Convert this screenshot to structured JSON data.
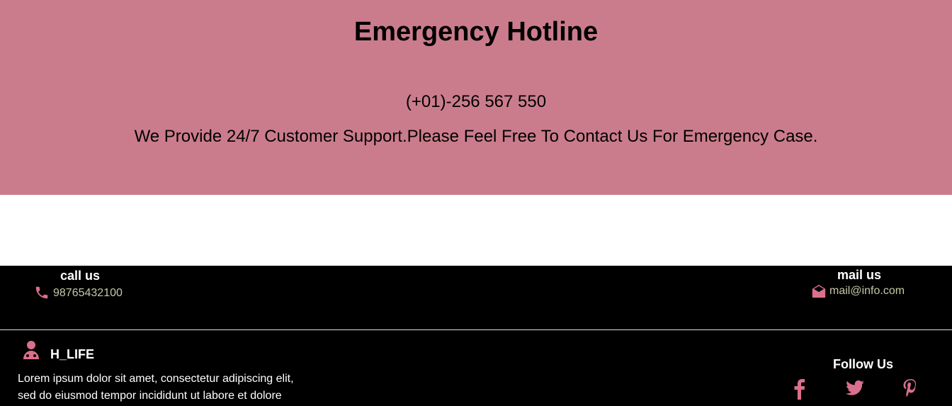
{
  "hotline": {
    "title": "Emergency Hotline",
    "phone": "(+01)-256 567 550",
    "description": "We Provide 24/7 Customer Support.Please Feel Free To Contact Us For Emergency Case."
  },
  "contact": {
    "call_heading": "call us",
    "call_number": "98765432100",
    "mail_heading": "mail us",
    "mail_address": "mail@info.com"
  },
  "footer": {
    "brand": "H_LIFE",
    "lorem_line1": "Lorem ipsum dolor sit amet, consectetur adipiscing elit,",
    "lorem_line2": "sed do eiusmod tempor incididunt ut labore et dolore",
    "follow_heading": "Follow Us",
    "social_icons": [
      "facebook-icon",
      "twitter-icon",
      "pinterest-icon"
    ]
  },
  "colors": {
    "hotline_bg": "#cb7c8c",
    "accent": "#d9708c",
    "footer_bg": "#000000"
  }
}
